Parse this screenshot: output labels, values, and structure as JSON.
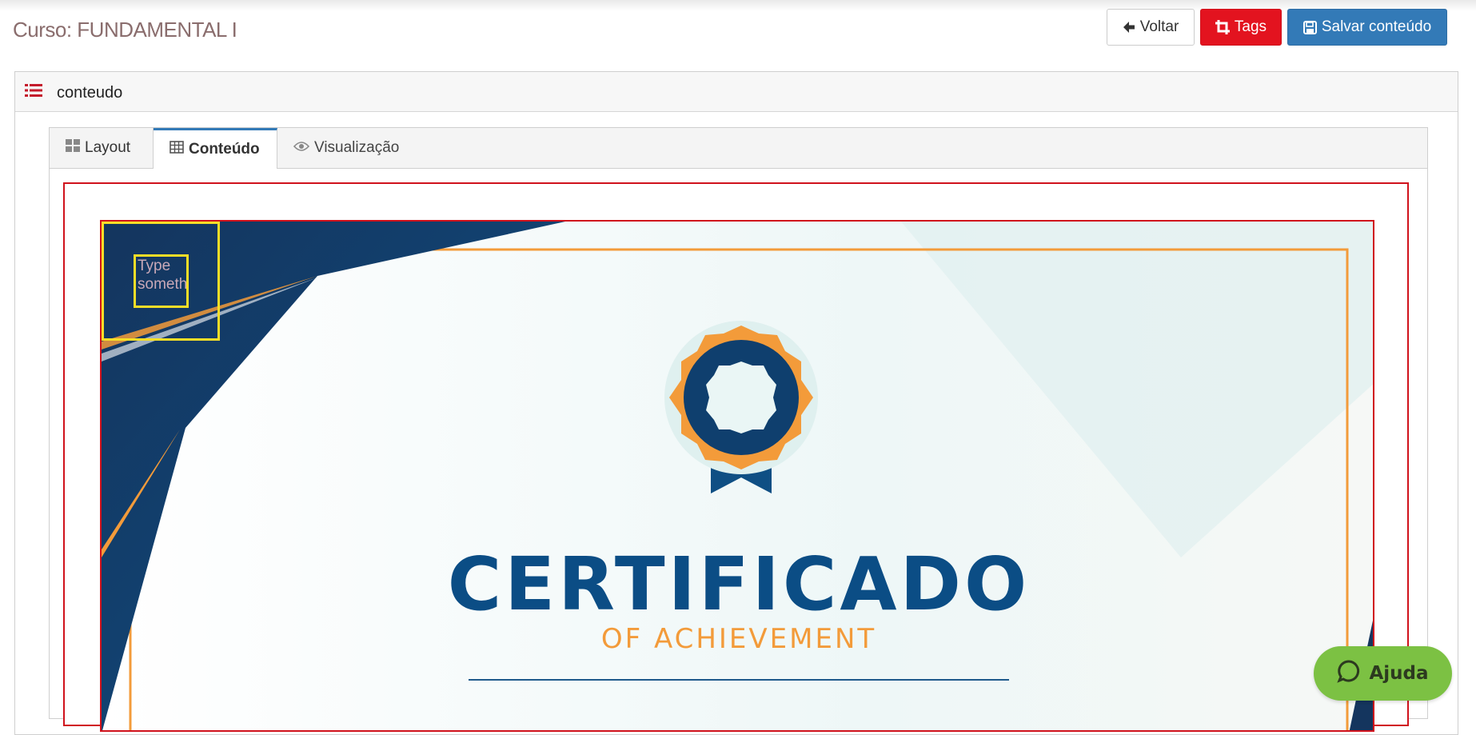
{
  "header": {
    "title": "Curso: FUNDAMENTAL I",
    "buttons": {
      "voltar": "Voltar",
      "tags": "Tags",
      "salvar": "Salvar conteúdo"
    }
  },
  "panel": {
    "icon": "list-icon",
    "label": "conteudo"
  },
  "tabs": [
    {
      "label": "Layout",
      "icon": "th-large-icon",
      "active": false
    },
    {
      "label": "Conteúdo",
      "icon": "table-icon",
      "active": true
    },
    {
      "label": "Visualização",
      "icon": "eye-icon",
      "active": false
    }
  ],
  "certificate": {
    "title": "CERTIFICADO",
    "subtitle": "OF ACHIEVEMENT",
    "text_box_placeholder": "Type someth"
  },
  "help": {
    "label": "Ajuda",
    "icon": "chat-bubble-icon"
  },
  "colors": {
    "tags_button": "#e3131f",
    "save_button": "#337ab7",
    "selection_outline": "#f7de27",
    "editor_border": "#d0121c",
    "certificate_blue": "#0b4d85",
    "certificate_orange": "#f39b3a",
    "help_button": "#7cc143"
  }
}
